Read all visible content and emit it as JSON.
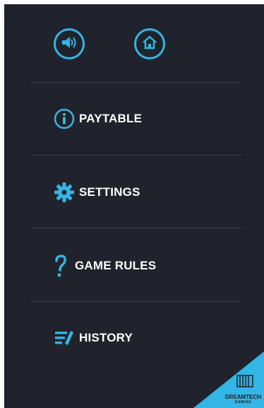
{
  "colors": {
    "background": "#20232b",
    "accent": "#33b5e5",
    "divider": "#3a3e47",
    "text": "#ffffff"
  },
  "top_buttons": [
    {
      "icon": "speaker-icon",
      "label": ""
    },
    {
      "icon": "home-icon",
      "label": ""
    }
  ],
  "menu": {
    "items": [
      {
        "icon": "info-icon",
        "label": "PAYTABLE"
      },
      {
        "icon": "gear-icon",
        "label": "SETTINGS"
      },
      {
        "icon": "question-mark-icon",
        "label": "GAME RULES"
      },
      {
        "icon": "history-icon",
        "label": "HISTORY"
      }
    ]
  },
  "brand": {
    "name": "DREAMTECH",
    "sub": "GAMING"
  }
}
